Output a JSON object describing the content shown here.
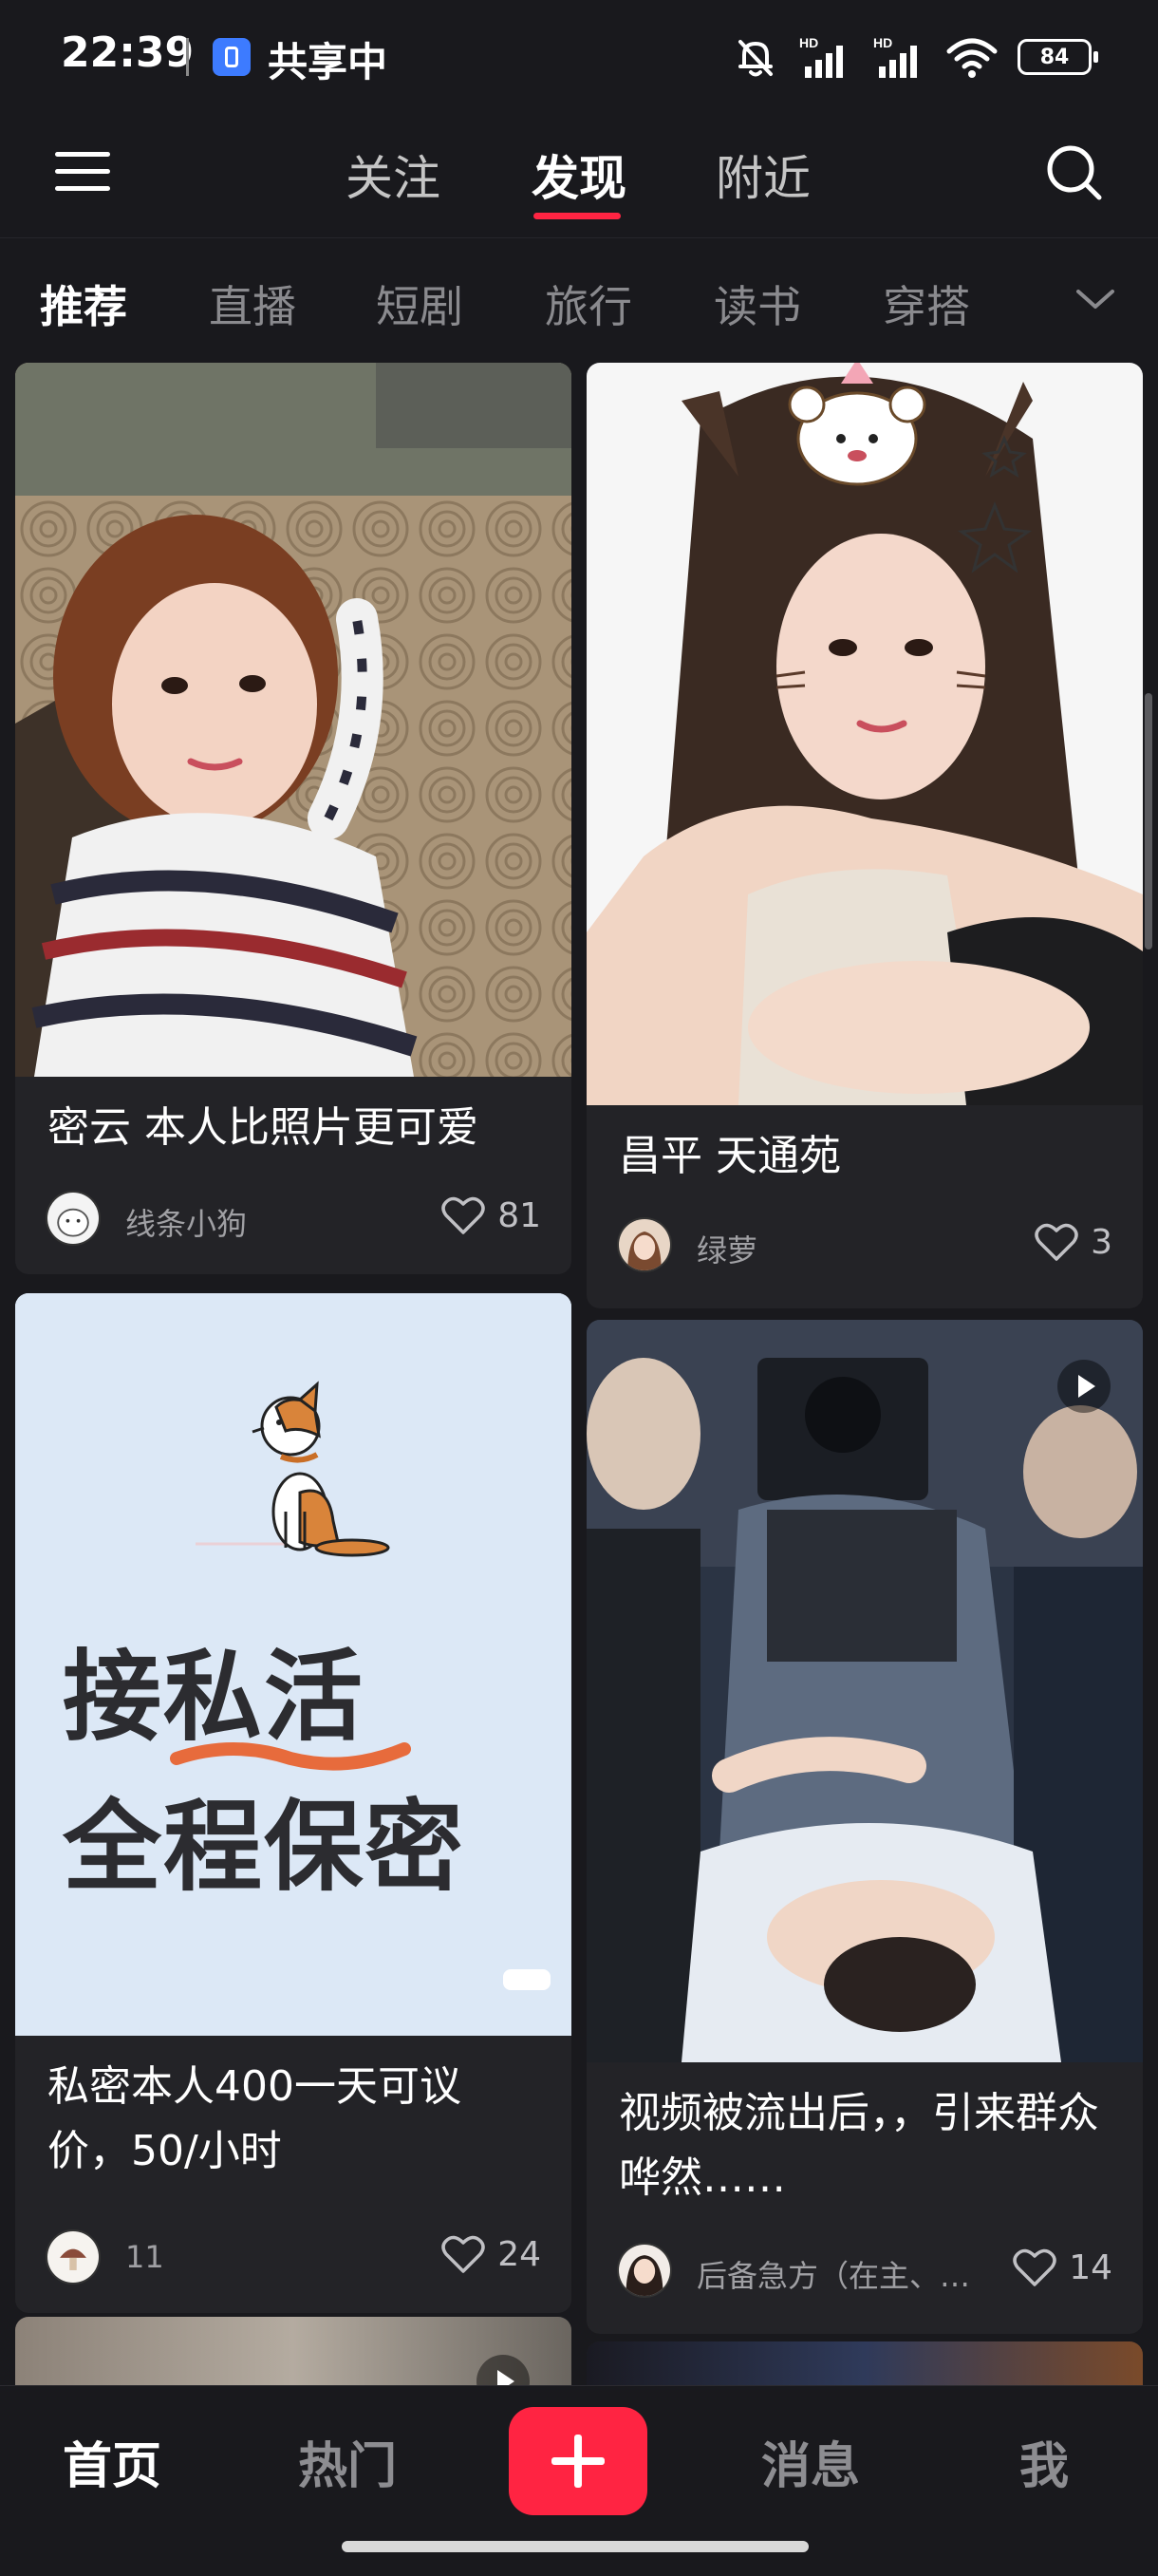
{
  "status_bar": {
    "time": "22:39",
    "share_label": "共享中",
    "battery": "84",
    "icons": [
      "share-screen-icon",
      "bell-muted-icon",
      "signal-hd-icon",
      "signal-hd-icon",
      "wifi-icon",
      "battery-icon"
    ]
  },
  "top_nav": {
    "tabs": [
      {
        "label": "关注"
      },
      {
        "label": "发现"
      },
      {
        "label": "附近"
      }
    ],
    "active_tab": "发现",
    "icons": {
      "menu": "menu-icon",
      "search": "search-icon"
    }
  },
  "categories": {
    "items": [
      {
        "label": "推荐"
      },
      {
        "label": "直播"
      },
      {
        "label": "短剧"
      },
      {
        "label": "旅行"
      },
      {
        "label": "读书"
      },
      {
        "label": "穿搭"
      }
    ],
    "active": "推荐"
  },
  "feed": {
    "left": [
      {
        "title": "密云 本人比照片更可爱",
        "author": "线条小狗",
        "likes": "81"
      },
      {
        "title": "私密本人400一天可议价，50/小时",
        "author": "11",
        "likes": "24",
        "image_text": [
          "接私活",
          "全程保密"
        ]
      }
    ],
    "right": [
      {
        "title": "昌平 天通苑",
        "author": "绿萝",
        "likes": "3"
      },
      {
        "title": "视频被流出后，，引来群众哗然……",
        "author": "后备急方（在主、…",
        "likes": "14",
        "is_video": true
      }
    ]
  },
  "bottom_nav": {
    "tabs": [
      {
        "label": "首页"
      },
      {
        "label": "热门"
      },
      {
        "label": "消息"
      },
      {
        "label": "我"
      }
    ],
    "active": "首页"
  },
  "colors": {
    "background": "#19191d",
    "card": "#232327",
    "accent": "#ff2442",
    "text_primary": "#ffffff",
    "text_secondary": "#8a8a8e"
  }
}
